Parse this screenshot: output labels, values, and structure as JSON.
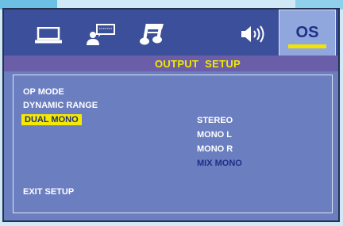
{
  "colors": {
    "screen_bg": "#6b7ec0",
    "iconbar_bg": "#3b4f9a",
    "titlebar_bg": "#6a5ea8",
    "highlight_yellow": "#f5e900",
    "selected_text": "#1f2f86",
    "text_white": "#ffffff",
    "active_tab_bg": "#8fa7dc"
  },
  "tabs": [
    {
      "icon": "monitor-icon"
    },
    {
      "icon": "language-chat-icon"
    },
    {
      "icon": "music-note-icon"
    },
    {
      "icon": "speaker-icon"
    },
    {
      "label": "OS",
      "selected": true
    }
  ],
  "header": {
    "title": "OUTPUT SETUP"
  },
  "menu": {
    "items": [
      {
        "label": "OP MODE"
      },
      {
        "label": "DYNAMIC RANGE"
      },
      {
        "label": "DUAL MONO",
        "selected": true
      }
    ],
    "exit_label": "EXIT SETUP"
  },
  "options": {
    "items": [
      {
        "label": "STEREO"
      },
      {
        "label": "MONO L"
      },
      {
        "label": "MONO R"
      },
      {
        "label": "MIX MONO",
        "active": true
      }
    ]
  }
}
